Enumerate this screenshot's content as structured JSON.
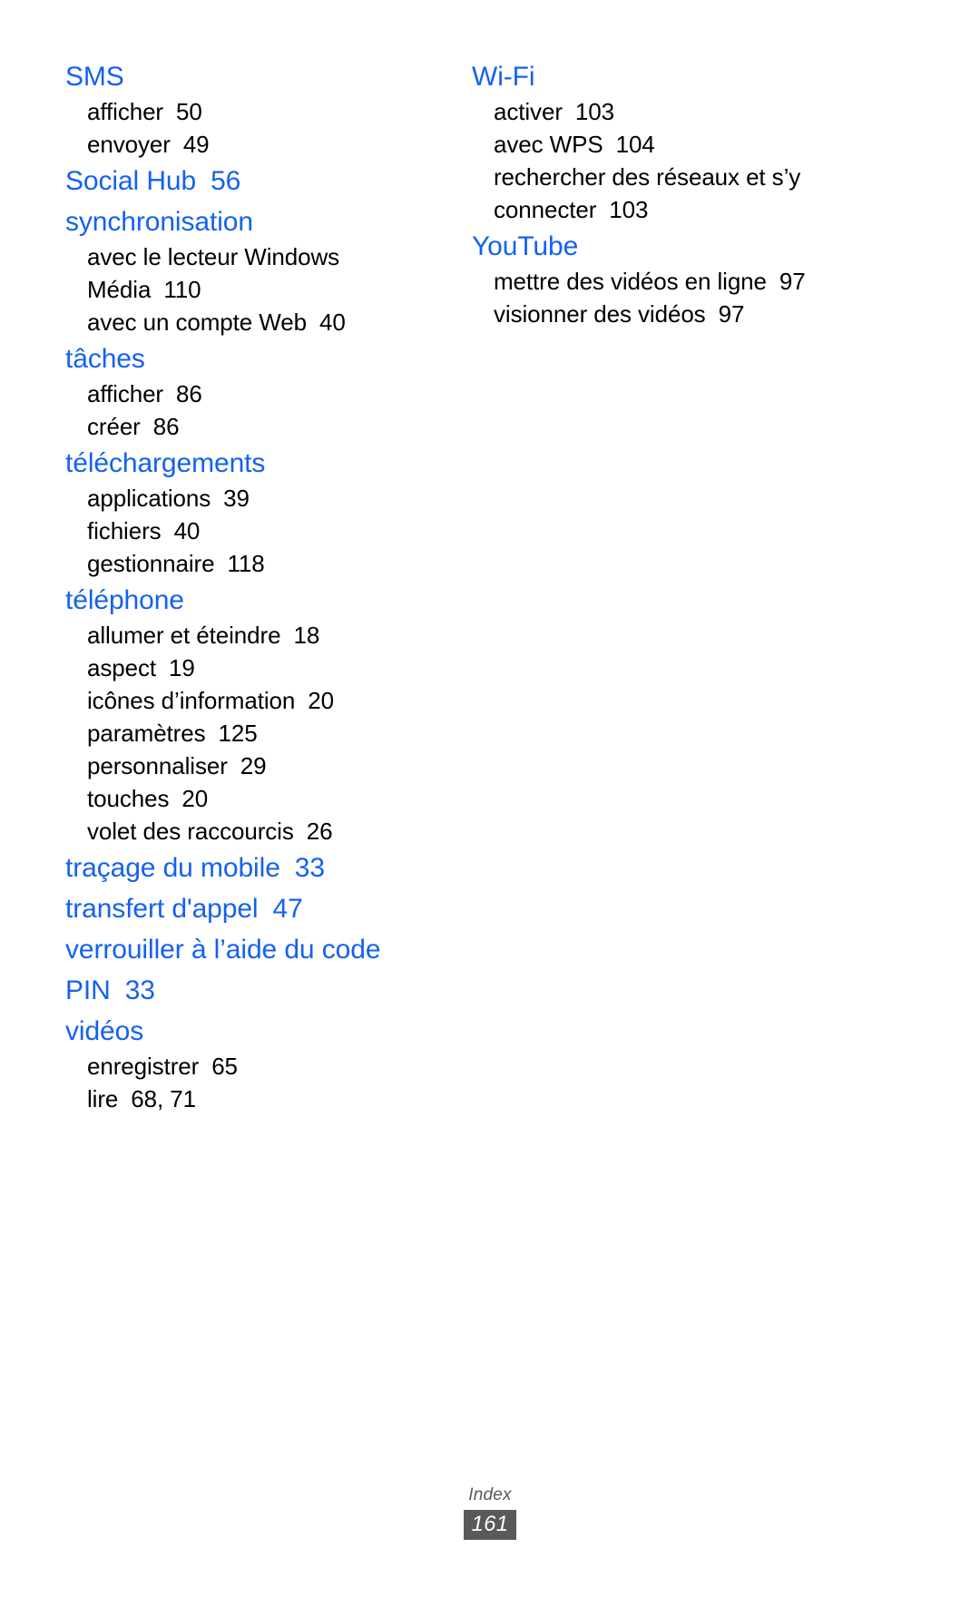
{
  "document": {
    "type": "index-page",
    "footer_label": "Index",
    "page_number": "161",
    "accent_color": "#1461F0",
    "body_color": "#000000",
    "footer_color": "#58595b"
  },
  "left_column": [
    {
      "heading": "SMS",
      "page": "",
      "subentries": [
        {
          "label": "afficher",
          "page": "50"
        },
        {
          "label": "envoyer",
          "page": "49"
        }
      ]
    },
    {
      "heading": "Social Hub",
      "page": "56",
      "subentries": []
    },
    {
      "heading": "synchronisation",
      "page": "",
      "subentries": [
        {
          "label": "avec le lecteur Windows Média",
          "page": "110"
        },
        {
          "label": "avec un compte Web",
          "page": "40"
        }
      ]
    },
    {
      "heading": "tâches",
      "page": "",
      "subentries": [
        {
          "label": "afficher",
          "page": "86"
        },
        {
          "label": "créer",
          "page": "86"
        }
      ]
    },
    {
      "heading": "téléchargements",
      "page": "",
      "subentries": [
        {
          "label": "applications",
          "page": "39"
        },
        {
          "label": "fichiers",
          "page": "40"
        },
        {
          "label": "gestionnaire",
          "page": "118"
        }
      ]
    },
    {
      "heading": "téléphone",
      "page": "",
      "subentries": [
        {
          "label": "allumer et éteindre",
          "page": "18"
        },
        {
          "label": "aspect",
          "page": "19"
        },
        {
          "label": "icônes d’information",
          "page": "20"
        },
        {
          "label": "paramètres",
          "page": "125"
        },
        {
          "label": "personnaliser",
          "page": "29"
        },
        {
          "label": "touches",
          "page": "20"
        },
        {
          "label": "volet des raccourcis",
          "page": "26"
        }
      ]
    },
    {
      "heading": "traçage du mobile",
      "page": "33",
      "subentries": []
    },
    {
      "heading": "transfert d'appel",
      "page": "47",
      "subentries": []
    },
    {
      "heading": "verrouiller à l’aide du code PIN",
      "page": "33",
      "subentries": []
    },
    {
      "heading": "vidéos",
      "page": "",
      "subentries": [
        {
          "label": "enregistrer",
          "page": "65"
        },
        {
          "label": "lire",
          "page": "68, 71"
        }
      ]
    }
  ],
  "right_column": [
    {
      "heading": "Wi-Fi",
      "page": "",
      "subentries": [
        {
          "label": "activer",
          "page": "103"
        },
        {
          "label": "avec WPS",
          "page": "104"
        },
        {
          "label": "rechercher des réseaux et s’y connecter",
          "page": "103"
        }
      ]
    },
    {
      "heading": "YouTube",
      "page": "",
      "subentries": [
        {
          "label": "mettre des vidéos en ligne",
          "page": "97"
        },
        {
          "label": "visionner des vidéos",
          "page": "97"
        }
      ]
    }
  ]
}
